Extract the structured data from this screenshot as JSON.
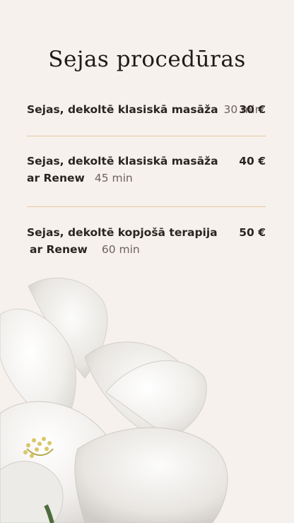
{
  "page": {
    "title": "Sejas procedūras"
  },
  "services": [
    {
      "name": "Sejas, dekoltē klasiskā masāža",
      "duration": "30 min",
      "price": "30 €"
    },
    {
      "name_line1": "Sejas, dekoltē klasiskā masāža",
      "name_line2": "ar Renew",
      "duration": "45 min",
      "price": "40 €"
    },
    {
      "name_line1": "Sejas, dekoltē kopjošā terapija",
      "name_line2": "ar Renew",
      "duration": "60 min",
      "price": "50 €"
    }
  ],
  "colors": {
    "background": "#f6f1ec",
    "divider": "#e6c79f",
    "text": "#2a2522",
    "muted": "#6c645e"
  },
  "decoration": {
    "icon": "white-flower-illustration"
  }
}
